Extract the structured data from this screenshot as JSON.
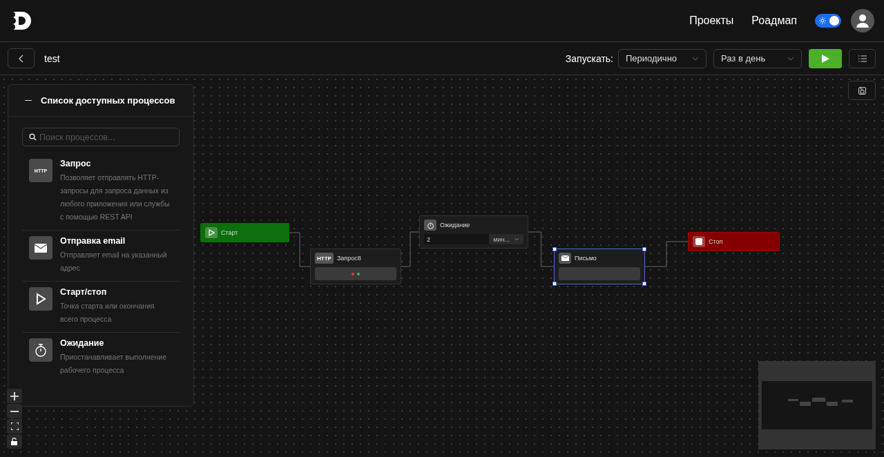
{
  "header": {
    "nav": [
      "Проекты",
      "Роадмап"
    ],
    "theme_toggle": {
      "on": true
    }
  },
  "toolbar": {
    "title": "test",
    "run_label": "Запускать:",
    "mode": "Периодично",
    "frequency": "Раз в день"
  },
  "panel": {
    "title": "Список доступных процессов",
    "search": {
      "placeholder": "Поиск процессов..."
    },
    "items": [
      {
        "kind": "http",
        "icon_text": "HTTP",
        "title": "Запрос",
        "description": "Позволяет отправлять HTTP-запросы для запроса данных из любого приложения или службы с помощью REST API"
      },
      {
        "kind": "email",
        "title": "Отправка email",
        "description": "Отправляет email на указанный адрес"
      },
      {
        "kind": "start",
        "title": "Старт/стоп",
        "description": "Точка старта или окончания всего процесса"
      },
      {
        "kind": "wait",
        "title": "Ожидание",
        "description": "Приостанавливает выполнение рабочего процесса"
      }
    ]
  },
  "nodes": [
    {
      "kind": "start",
      "label": "Старт",
      "selected": false
    },
    {
      "kind": "http",
      "label": "Запрос8",
      "icon_text": "HTTP",
      "selected": false
    },
    {
      "kind": "wait",
      "label": "Ожидание",
      "value": "2",
      "unit": "мин...",
      "selected": false
    },
    {
      "kind": "email",
      "label": "Письмо",
      "selected": true
    },
    {
      "kind": "stop",
      "label": "Стоп",
      "selected": false
    }
  ]
}
